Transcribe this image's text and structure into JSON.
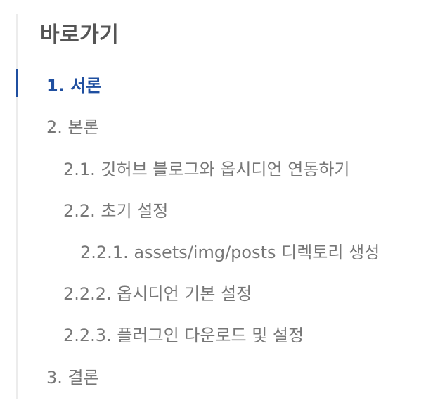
{
  "toc": {
    "title": "바로가기",
    "accent_color": "#1f4fa0",
    "items": [
      {
        "label": "1. 서론",
        "level": 1,
        "active": true
      },
      {
        "label": "2. 본론",
        "level": 1,
        "active": false
      },
      {
        "label": "2.1. 깃허브 블로그와 옵시디언 연동하기",
        "level": 2,
        "active": false
      },
      {
        "label": "2.2. 초기 설정",
        "level": 2,
        "active": false
      },
      {
        "label": "2.2.1. assets/img/posts 디렉토리 생성",
        "level": 3,
        "active": false
      },
      {
        "label": "2.2.2. 옵시디언 기본 설정",
        "level": 2,
        "active": false
      },
      {
        "label": "2.2.3. 플러그인 다운로드 및 설정",
        "level": 2,
        "active": false
      },
      {
        "label": "3. 결론",
        "level": 1,
        "active": false
      }
    ]
  }
}
